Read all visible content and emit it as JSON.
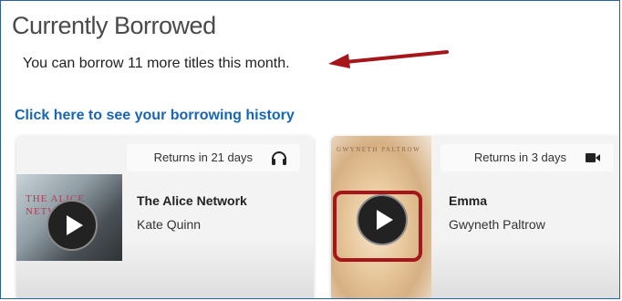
{
  "page": {
    "title": "Currently Borrowed",
    "allowance": "You can borrow 11 more titles this month.",
    "history_link": "Click here to see your borrowing history"
  },
  "cards": [
    {
      "returns": "Returns in 21 days",
      "format_icon": "headphones-icon",
      "cover_text": "THE ALICE NETWORK",
      "title": "The Alice Network",
      "author": "Kate Quinn"
    },
    {
      "returns": "Returns in 3 days",
      "format_icon": "video-camera-icon",
      "cover_text": "GWYNETH PALTROW",
      "title": "Emma",
      "author": "Gwyneth Paltrow"
    }
  ],
  "colors": {
    "link": "#1766b3",
    "annotation": "#a4161a",
    "frame": "#2b5f9e"
  }
}
